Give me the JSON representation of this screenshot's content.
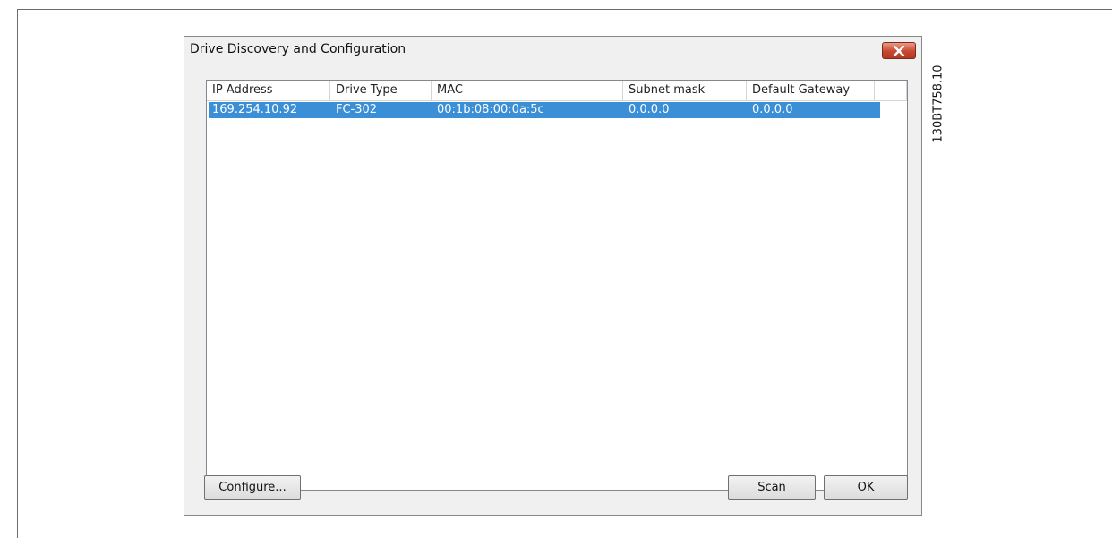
{
  "dialog": {
    "title": "Drive Discovery and Configuration",
    "close_icon": "close-icon"
  },
  "table": {
    "columns": [
      "IP Address",
      "Drive Type",
      "MAC",
      "Subnet mask",
      "Default Gateway"
    ],
    "rows": [
      {
        "ip": "169.254.10.92",
        "drive_type": "FC-302",
        "mac": "00:1b:08:00:0a:5c",
        "subnet": "0.0.0.0",
        "gateway": "0.0.0.0",
        "selected": true
      }
    ],
    "selection_color": "#3a8fd6"
  },
  "buttons": {
    "configure": "Configure...",
    "scan": "Scan",
    "ok": "OK"
  },
  "figure_code": "130BT758.10"
}
